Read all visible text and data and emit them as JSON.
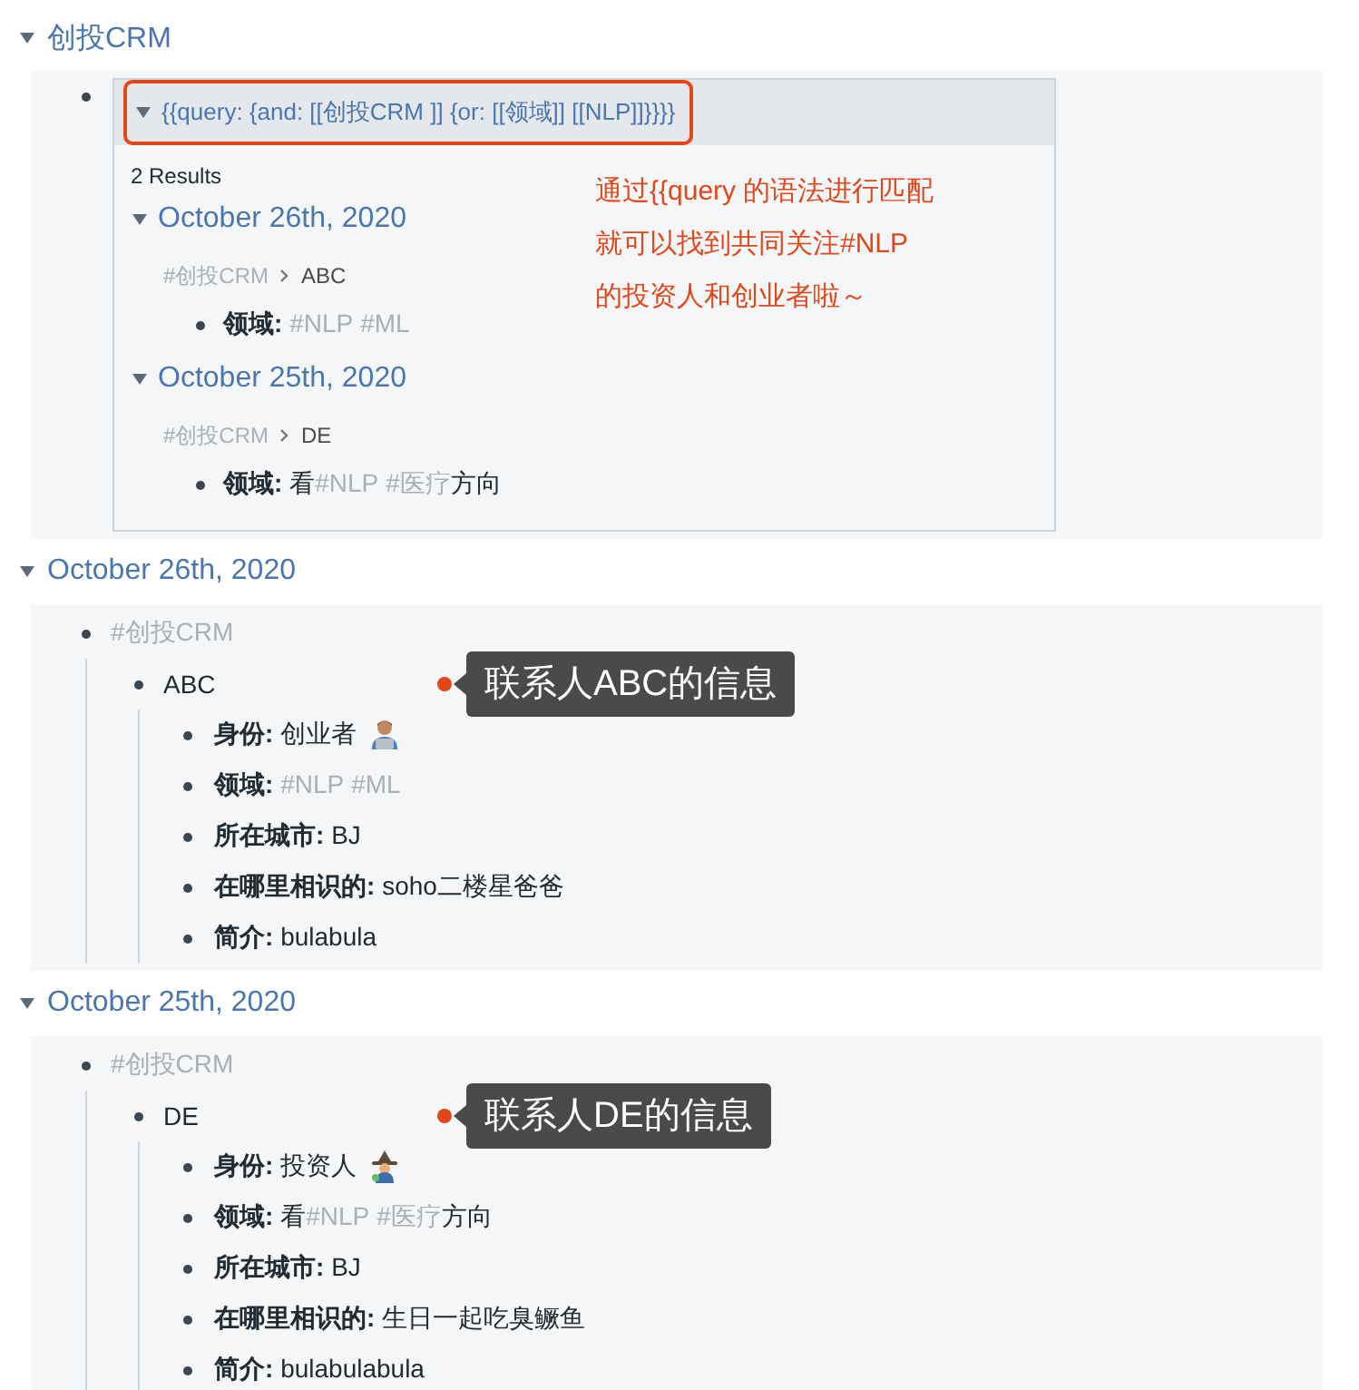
{
  "page_title": {
    "text": "创投CRM",
    "expanded": true
  },
  "query": {
    "text": "{{query:  {and: [[创投CRM ]] {or: [[领域]] [[NLP]]}}}}",
    "expanded": true,
    "highlighted": true,
    "result_count": "2 Results",
    "results": [
      {
        "date": "October 26th, 2020",
        "expanded": true,
        "breadcrumb": [
          "#创投CRM",
          "ABC"
        ],
        "properties": [
          {
            "label": "领域:",
            "segments": [
              {
                "kind": "tag",
                "text": "#NLP"
              },
              {
                "kind": "tag",
                "text": "#ML"
              }
            ]
          }
        ]
      },
      {
        "date": "October 25th, 2020",
        "expanded": true,
        "breadcrumb": [
          "#创投CRM",
          "DE"
        ],
        "properties": [
          {
            "label": "领域:",
            "segments": [
              {
                "kind": "text",
                "text": "看"
              },
              {
                "kind": "tag",
                "text": "#NLP"
              },
              {
                "kind": "tag",
                "text": "#医疗"
              },
              {
                "kind": "text",
                "text": "方向"
              }
            ]
          }
        ]
      }
    ]
  },
  "annotation": [
    "通过{{query 的语法进行匹配",
    "就可以找到共同关注#NLP",
    "的投资人和创业者啦～"
  ],
  "sections": [
    {
      "date": "October 26th, 2020",
      "expanded": true,
      "tag": "#创投CRM",
      "contact": "ABC",
      "callout": "联系人ABC的信息",
      "properties": [
        {
          "label": "身份:",
          "segments": [
            {
              "kind": "text",
              "text": "创业者"
            }
          ]
        },
        {
          "label": "领域:",
          "segments": [
            {
              "kind": "tag",
              "text": "#NLP"
            },
            {
              "kind": "tag",
              "text": "#ML"
            }
          ]
        },
        {
          "label": "所在城市:",
          "segments": [
            {
              "kind": "text",
              "text": "BJ"
            }
          ]
        },
        {
          "label": "在哪里相识的:",
          "segments": [
            {
              "kind": "text",
              "text": "soho二楼星爸爸"
            }
          ]
        },
        {
          "label": "简介:",
          "segments": [
            {
              "kind": "text",
              "text": "bulabula"
            }
          ]
        }
      ]
    },
    {
      "date": "October 25th, 2020",
      "expanded": true,
      "tag": "#创投CRM",
      "contact": "DE",
      "callout": "联系人DE的信息",
      "properties": [
        {
          "label": "身份:",
          "segments": [
            {
              "kind": "text",
              "text": "投资人"
            }
          ]
        },
        {
          "label": "领域:",
          "segments": [
            {
              "kind": "text",
              "text": "看"
            },
            {
              "kind": "tag",
              "text": "#NLP"
            },
            {
              "kind": "tag",
              "text": "#医疗"
            },
            {
              "kind": "text",
              "text": "方向"
            }
          ]
        },
        {
          "label": "所在城市:",
          "segments": [
            {
              "kind": "text",
              "text": "BJ"
            }
          ]
        },
        {
          "label": "在哪里相识的:",
          "segments": [
            {
              "kind": "text",
              "text": "生日一起吃臭鳜鱼"
            }
          ]
        },
        {
          "label": "简介:",
          "segments": [
            {
              "kind": "text",
              "text": "bulabulabula"
            }
          ]
        }
      ]
    }
  ]
}
